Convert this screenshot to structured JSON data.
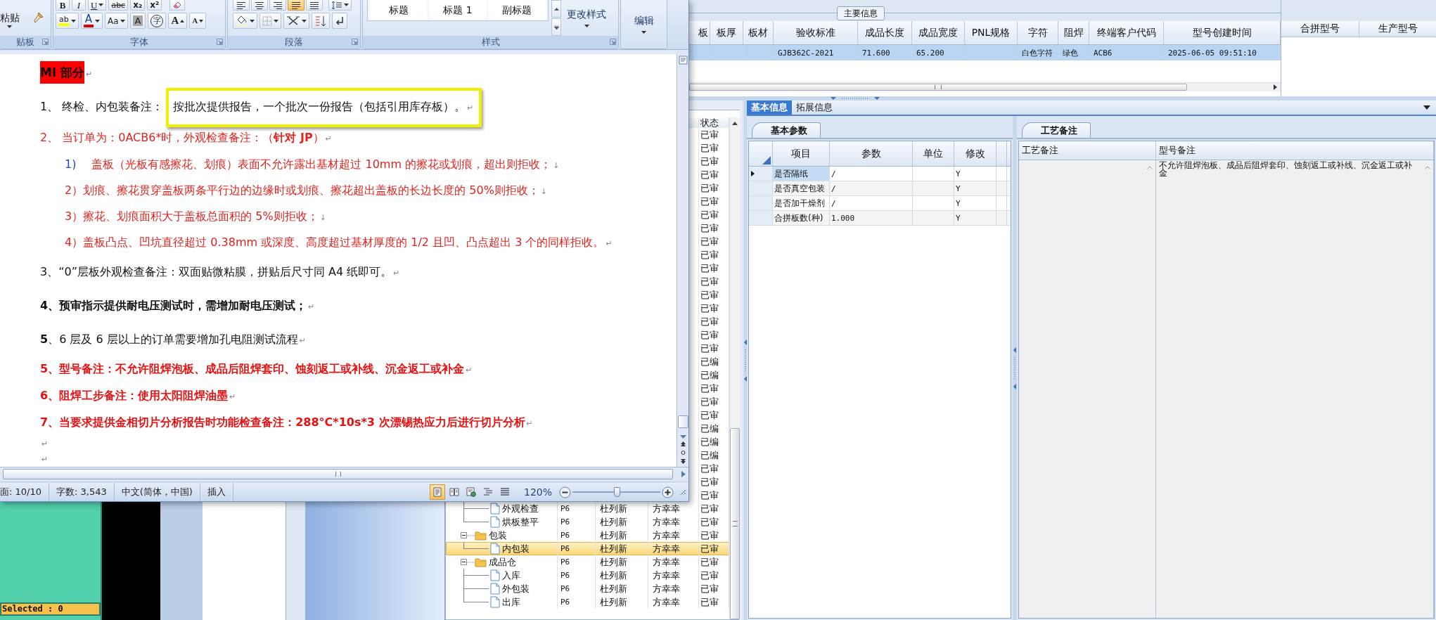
{
  "main_info": {
    "legend": "主要信息",
    "columns": [
      "板",
      "板厚",
      "板材",
      "验收标准",
      "成品长度",
      "成品宽度",
      "PNL规格",
      "字符",
      "阻焊",
      "终端客户代码",
      "型号创建时间"
    ],
    "rows": [
      {
        "cells": [
          null,
          null,
          null,
          "GJB362C-2021",
          "71.600",
          "65.200",
          null,
          "白色字符",
          "绿色",
          "ACB6",
          "2025-06-05 09:51:10"
        ],
        "selected": true
      }
    ]
  },
  "side_table": {
    "columns": [
      "合拼型号",
      "生产型号"
    ]
  },
  "tree_list": {
    "status_header": "状态",
    "status_rows": [
      "已审",
      "已审",
      "已审",
      "已审",
      "已审",
      "已审",
      "已审",
      "已审",
      "已审",
      "已审",
      "已审",
      "已审",
      "已审",
      "已审",
      "已审",
      "已审",
      "已审",
      "已编",
      "已编",
      "已审",
      "已审",
      "已审",
      "已编",
      "已编",
      "已编",
      "已审",
      "已审",
      "已审"
    ],
    "continued_children": [
      {
        "name": "外观检查",
        "kind": "doc",
        "cells": [
          "P6",
          "杜列新",
          "方幸幸"
        ],
        "status": "已审",
        "selected": false
      },
      {
        "name": "烘板整平",
        "kind": "doc",
        "cells": [
          "P6",
          "杜列新",
          "方幸幸"
        ],
        "status": "已审",
        "selected": false
      }
    ],
    "nodes": [
      {
        "name": "包装",
        "kind": "folder",
        "expanded": true,
        "cells": [
          "P6",
          "杜列新",
          "方幸幸"
        ],
        "status": "已审",
        "selected": false,
        "children": [
          {
            "name": "内包装",
            "kind": "doc",
            "cells": [
              "P6",
              "杜列新",
              "方幸幸"
            ],
            "status": "已审",
            "selected": true
          }
        ]
      },
      {
        "name": "成品仓",
        "kind": "folder",
        "expanded": true,
        "cells": [
          "P6",
          "杜列新",
          "方幸幸"
        ],
        "status": "已审",
        "selected": false,
        "children": [
          {
            "name": "入库",
            "kind": "doc",
            "cells": [
              "P6",
              "杜列新",
              "方幸幸"
            ],
            "status": "已审",
            "selected": false
          },
          {
            "name": "外包装",
            "kind": "doc",
            "cells": [
              "P6",
              "杜列新",
              "方幸幸"
            ],
            "status": "已审",
            "selected": false
          },
          {
            "name": "出库",
            "kind": "doc",
            "cells": [
              "P6",
              "杜列新",
              "方幸幸"
            ],
            "status": "已审",
            "selected": false
          }
        ]
      }
    ]
  },
  "selected_bar": "Selected : 0",
  "detail_tabs": [
    {
      "label": "基本信息",
      "selected": true
    },
    {
      "label": "拓展信息",
      "selected": false
    }
  ],
  "params": {
    "tab": "基本参数",
    "columns": [
      "项目",
      "参数",
      "单位",
      "修改"
    ],
    "rows": [
      {
        "item": "是否隔纸",
        "value": "/",
        "modify": "Y",
        "selected": true
      },
      {
        "item": "是否真空包装",
        "value": "/",
        "modify": "Y",
        "selected": false
      },
      {
        "item": "是否加干燥剂",
        "value": "/",
        "modify": "Y",
        "selected": false
      },
      {
        "item": "合拼板数(种)",
        "value": "1.000",
        "modify": "Y",
        "selected": false
      }
    ]
  },
  "remarks": {
    "tab": "工艺备注",
    "columns": [
      "工艺备注",
      "型号备注"
    ],
    "model_remark": "不允许阻焊泡板、成品后阻焊套印、蚀刻返工或补线、沉金返工或补金"
  },
  "word": {
    "ribbon": {
      "clipboard": {
        "paste": "粘贴",
        "group_label": "贴板"
      },
      "font": {
        "group_label": "字体",
        "row1": [
          {
            "label": "B",
            "kind": "bold"
          },
          {
            "label": "I",
            "kind": "italic"
          },
          {
            "label": "U",
            "kind": "underline"
          },
          {
            "label": "abc",
            "kind": "strike"
          },
          {
            "label": "x₂",
            "kind": "sub"
          },
          {
            "label": "x²",
            "kind": "sup"
          }
        ],
        "row2": [
          {
            "label": "ab",
            "kind": "highlight"
          },
          {
            "label": "A",
            "kind": "color"
          },
          {
            "label": "Aa",
            "kind": "case"
          },
          {
            "label": "A",
            "kind": "shade"
          },
          {
            "label": "字",
            "kind": "circle"
          },
          {
            "label": "A",
            "kind": "grow"
          },
          {
            "label": "A",
            "kind": "shrink"
          }
        ]
      },
      "paragraph": {
        "group_label": "段落",
        "alignments": [
          {
            "kind": "left",
            "selected": false
          },
          {
            "kind": "center",
            "selected": false
          },
          {
            "kind": "right",
            "selected": false
          },
          {
            "kind": "justify",
            "selected": true
          },
          {
            "kind": "distributed",
            "selected": false
          }
        ]
      },
      "styles": {
        "group_label": "样式",
        "gallery": [
          "标题",
          "标题 1",
          "副标题"
        ],
        "change": "更改样式"
      },
      "editing": {
        "label": "编辑"
      }
    },
    "document": {
      "lines": [
        {
          "kind": "heading",
          "parts": [
            {
              "text": "MI 部分"
            }
          ],
          "mark": "↵"
        },
        {
          "kind": "framed",
          "parts": [
            {
              "text": "1、 终检、内包装备注："
            }
          ],
          "framed": "按批次提供报告，一个批次一份报告（包括引用库存板）。",
          "mark": "↵"
        },
        {
          "kind": "item",
          "parts": [
            {
              "text": "2、 当订单为：0ACB6*时，外观检查备注：（",
              "bold": false
            },
            {
              "text": "针对 JP",
              "bold": true
            },
            {
              "text": "）",
              "bold": false
            }
          ],
          "mark": "↵"
        },
        {
          "kind": "sub",
          "number": "1)",
          "parts": [
            {
              "text": "盖板（光板有感擦花、划痕）表面不允许露出基材超过 10mm 的擦花或划痕，超出则拒收；"
            }
          ],
          "mark": "↓"
        },
        {
          "kind": "sub",
          "parts": [
            {
              "text": "2）划痕、擦花贯穿盖板两条平行边的边缘时或划痕、擦花超出盖板的长边长度的 50%则拒收；"
            }
          ],
          "mark": "↓"
        },
        {
          "kind": "sub",
          "parts": [
            {
              "text": "3）擦花、划痕面积大于盖板总面积的 5%则拒收；"
            }
          ],
          "mark": "↓"
        },
        {
          "kind": "sub",
          "parts": [
            {
              "text": "4）盖板凸点、凹坑直径超过 0.38mm 或深度、高度超过基材厚度的 1/2 且凹、凸点超出 3 个的同样拒收。"
            }
          ],
          "mark": "↵"
        },
        {
          "kind": "plain",
          "parts": [
            {
              "text": "3、“0”层板外观检查备注：双面贴微粘膜，拼贴后尺寸同 A4 纸即可。"
            }
          ],
          "mark": "↵"
        },
        {
          "kind": "strong",
          "parts": [
            {
              "text": "4、预审指示提供耐电压测试时，需增加耐电压测试；"
            }
          ],
          "mark": "↵"
        },
        {
          "kind": "plain",
          "parts": [
            {
              "text": "5",
              "bold": true
            },
            {
              "text": "、6 层及 6 层以上的订单需要增加孔电阻测试流程",
              "bold": false
            }
          ],
          "mark": "↵"
        },
        {
          "kind": "note",
          "parts": [
            {
              "text": "5、型号备注：不允许阻焊泡板、成品后阻焊套印、蚀刻返工或补线、沉金返工或补金"
            }
          ],
          "mark": "↵"
        },
        {
          "kind": "note",
          "parts": [
            {
              "text": "6、阻焊工步备注：使用太阳阻焊油墨"
            }
          ],
          "mark": "↵"
        },
        {
          "kind": "note",
          "parts": [
            {
              "text": "7、当要求提供金相切片分析报告时功能检查备注：288°C*10s*3 次漂锡热应力后进行切片分析"
            }
          ],
          "mark": "↵"
        },
        {
          "kind": "empty",
          "mark": "↵"
        },
        {
          "kind": "empty",
          "mark": "↵"
        }
      ]
    },
    "status_bar": {
      "items": [
        "面: 10/10",
        "字数: 3,543",
        "中文(简体，中国)",
        "插入"
      ],
      "views": [
        {
          "kind": "print",
          "selected": true
        },
        {
          "kind": "reading",
          "selected": false
        },
        {
          "kind": "web",
          "selected": false
        },
        {
          "kind": "outline",
          "selected": false
        },
        {
          "kind": "draft",
          "selected": false
        }
      ],
      "zoom": "120%",
      "zoom_slider": {
        "level": 0.5
      }
    }
  }
}
